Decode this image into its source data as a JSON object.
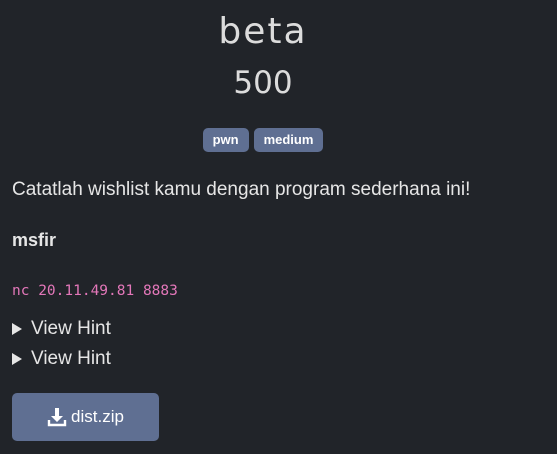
{
  "challenge": {
    "name": "beta",
    "points": "500",
    "tags": [
      "pwn",
      "medium"
    ],
    "description": "Catatlah wishlist kamu dengan program sederhana ini!",
    "author": "msfir",
    "connection": "nc 20.11.49.81 8883"
  },
  "hints": [
    {
      "label": "View Hint",
      "icon": "disclosure-triangle-icon"
    },
    {
      "label": "View Hint",
      "icon": "disclosure-triangle-icon"
    }
  ],
  "file": {
    "label": "dist.zip",
    "icon": "download-icon"
  },
  "colors": {
    "background": "#212429",
    "badge": "#5f6f92",
    "button": "#5f6f92",
    "connection_text": "#e377b9"
  }
}
